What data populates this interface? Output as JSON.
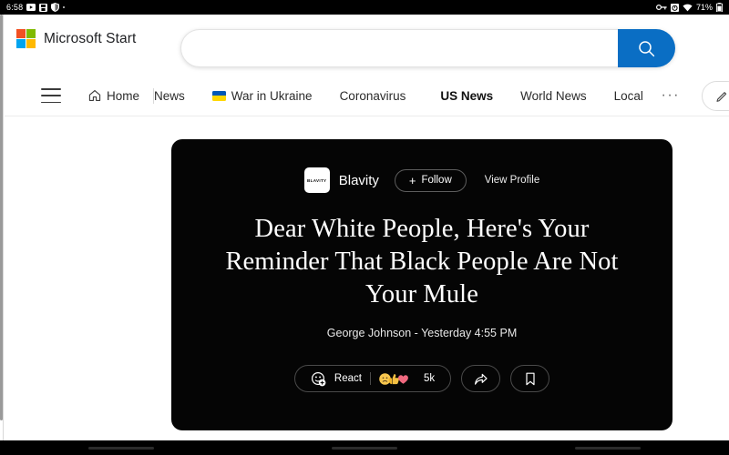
{
  "status_bar": {
    "time": "6:58",
    "icons_left": [
      "video-icon",
      "save-icon",
      "shield-icon",
      "dot-indicator"
    ],
    "icons_right": [
      "vpn-key-icon",
      "alarm-icon",
      "wifi-icon"
    ],
    "battery": "71%",
    "battery_icon": "battery-icon"
  },
  "header": {
    "brand": "Microsoft Start",
    "logo": "microsoft-logo",
    "logo_colors": {
      "red": "#f25022",
      "green": "#7fba00",
      "blue": "#00a4ef",
      "yellow": "#ffb900"
    },
    "search": {
      "value": "",
      "placeholder": "",
      "button_icon": "search-icon",
      "button_color": "#0a6ec4"
    }
  },
  "nav": {
    "menu_icon": "hamburger-icon",
    "items": [
      {
        "label": "Home",
        "icon": "home-icon",
        "active": false
      },
      {
        "label": "News",
        "icon": "",
        "active": false
      },
      {
        "label": "War in Ukraine",
        "icon": "ukraine-flag-icon",
        "active": false
      },
      {
        "label": "Coronavirus",
        "icon": "",
        "active": false
      },
      {
        "label": "US News",
        "icon": "",
        "active": true
      },
      {
        "label": "World News",
        "icon": "",
        "active": false
      },
      {
        "label": "Local",
        "icon": "",
        "active": false
      }
    ],
    "more_label": "···",
    "edit_icon": "pencil-icon"
  },
  "article": {
    "publisher": {
      "name": "Blavity",
      "logo_text": "BLAVITY",
      "logo": "blavity-logo"
    },
    "follow_button": {
      "label": "Follow",
      "icon": "plus-icon"
    },
    "view_profile_label": "View Profile",
    "headline": "Dear White People, Here's Your Reminder That Black People Are Not Your Mule",
    "byline": "George Johnson - Yesterday 4:55 PM",
    "background_color": "#050505",
    "actions": {
      "react_label": "React",
      "react_icon": "emoji-add-icon",
      "reactions": [
        {
          "name": "thinking-face-emoji",
          "color": "#f7c64e"
        },
        {
          "name": "thumbs-up-emoji",
          "color": "#f5c043"
        },
        {
          "name": "heart-emoji",
          "color": "#f0697f"
        }
      ],
      "reaction_count": "5k",
      "share_icon": "share-icon",
      "bookmark_icon": "bookmark-icon"
    }
  },
  "system_nav": {
    "buttons": [
      "recents-button",
      "home-button",
      "back-button"
    ]
  }
}
